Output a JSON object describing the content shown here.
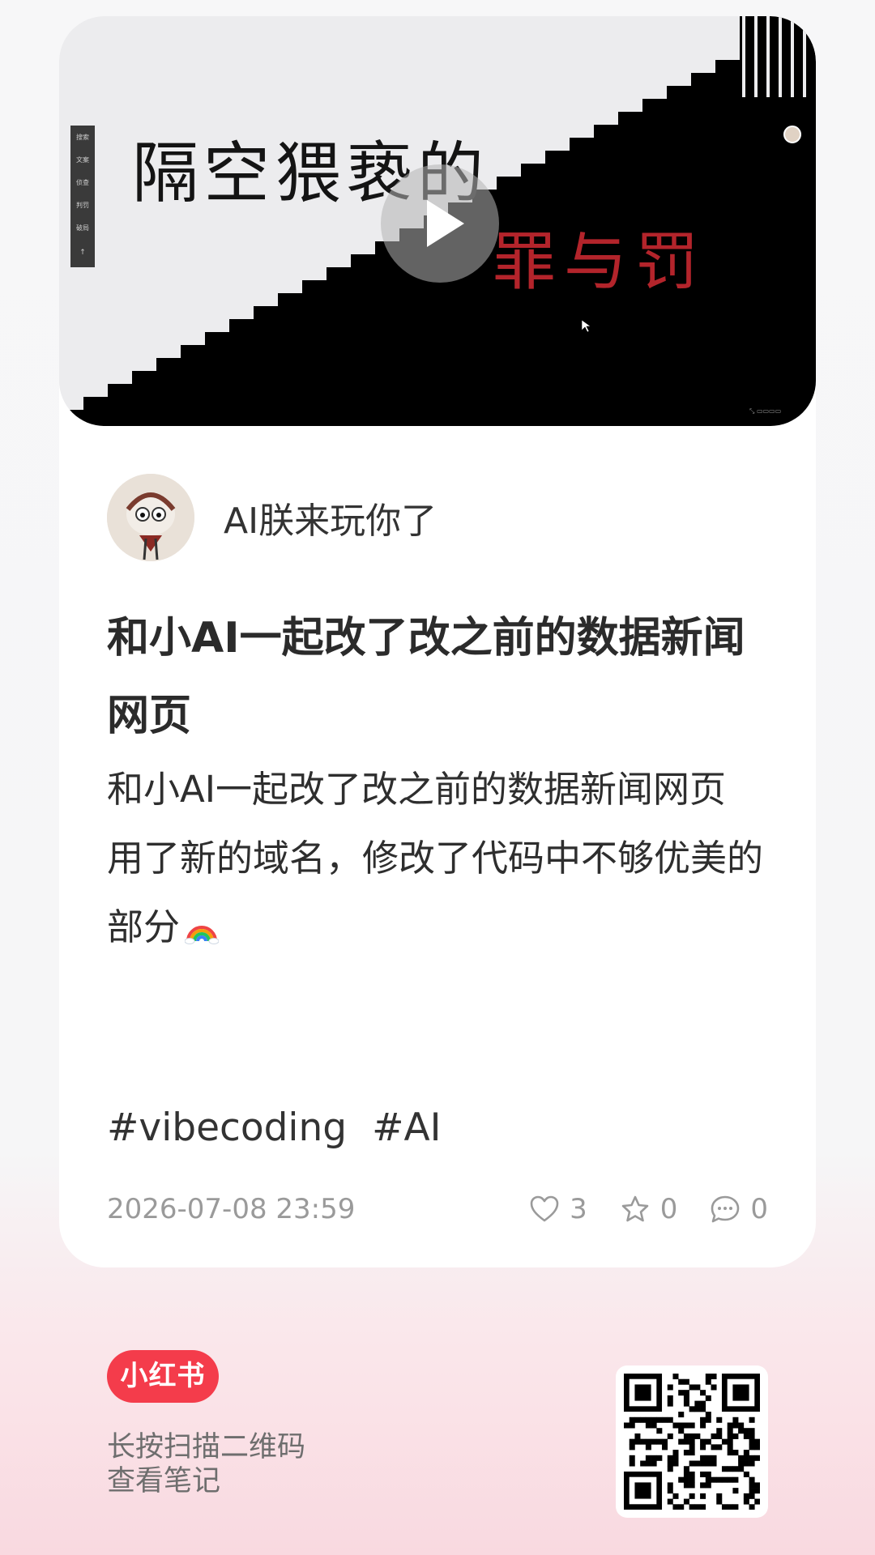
{
  "video": {
    "cover_title": "隔空猥亵的",
    "cover_subtitle": "罪与罚",
    "side_menu": [
      "搜索",
      "文案",
      "侦查",
      "判罚",
      "破局",
      "↑"
    ]
  },
  "author": {
    "name": "AI朕来玩你了"
  },
  "note": {
    "title": "和小AI一起改了改之前的数据新闻网页",
    "body_lines": [
      "和小AI一起改了改之前的数据新闻网页",
      "用了新的域名，修改了代码中不够优美的部分"
    ],
    "tags": [
      "#vibecoding",
      "#AI"
    ],
    "timestamp": "2026-07-08 23:59",
    "likes": "3",
    "collects": "0",
    "comments": "0"
  },
  "footer": {
    "brand": "小红书",
    "scan_line1": "长按扫描二维码",
    "scan_line2": "查看笔记"
  },
  "colors": {
    "brand_red": "#f43c4b",
    "cover_red": "#b3242b"
  }
}
